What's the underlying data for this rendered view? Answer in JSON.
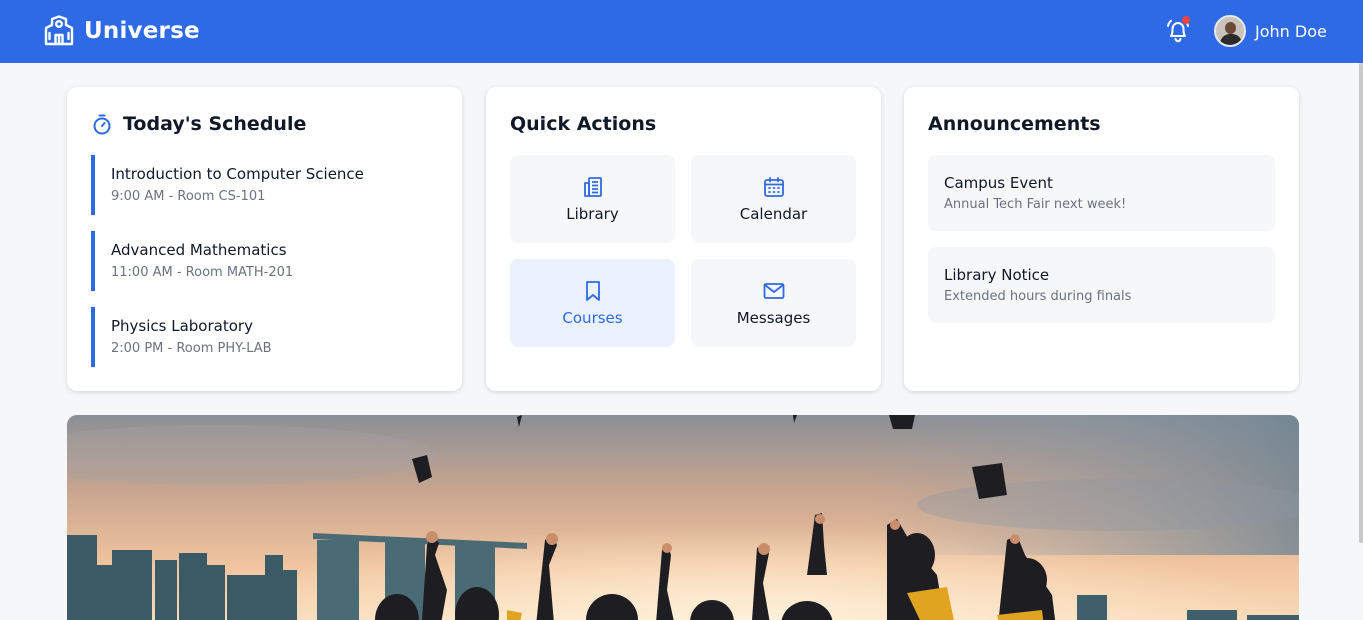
{
  "app": {
    "title": "Universe"
  },
  "header": {
    "user_name": "John Doe"
  },
  "schedule": {
    "title": "Today's Schedule",
    "items": [
      {
        "course": "Introduction to Computer Science",
        "when": "9:00 AM - Room CS-101"
      },
      {
        "course": "Advanced Mathematics",
        "when": "11:00 AM - Room MATH-201"
      },
      {
        "course": "Physics Laboratory",
        "when": "2:00 PM - Room PHY-LAB"
      }
    ]
  },
  "quick_actions": {
    "title": "Quick Actions",
    "items": [
      {
        "label": "Library",
        "icon": "library-icon"
      },
      {
        "label": "Calendar",
        "icon": "calendar-icon"
      },
      {
        "label": "Courses",
        "icon": "bookmark-icon",
        "active": true
      },
      {
        "label": "Messages",
        "icon": "mail-icon"
      }
    ]
  },
  "announcements": {
    "title": "Announcements",
    "items": [
      {
        "title": "Campus Event",
        "body": "Annual Tech Fair next week!"
      },
      {
        "title": "Library Notice",
        "body": "Extended hours during finals"
      }
    ]
  },
  "colors": {
    "primary": "#2f6ae6",
    "notification": "#ef4444",
    "background": "#f6f7f9"
  }
}
